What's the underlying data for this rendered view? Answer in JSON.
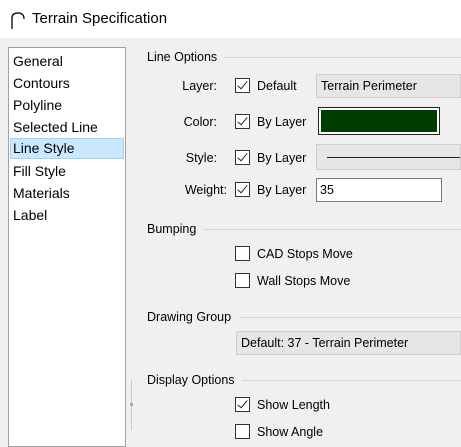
{
  "window": {
    "title": "Terrain Specification"
  },
  "nav": {
    "items": [
      {
        "label": "General"
      },
      {
        "label": "Contours"
      },
      {
        "label": "Polyline"
      },
      {
        "label": "Selected Line"
      },
      {
        "label": "Line Style",
        "selected": true
      },
      {
        "label": "Fill Style"
      },
      {
        "label": "Materials"
      },
      {
        "label": "Label"
      }
    ]
  },
  "line_options": {
    "heading": "Line Options",
    "layer": {
      "label": "Layer:",
      "checkbox_label": "Default",
      "checked": true,
      "value": "Terrain Perimeter"
    },
    "color": {
      "label": "Color:",
      "checkbox_label": "By Layer",
      "checked": true,
      "swatch": "#003d00"
    },
    "style": {
      "label": "Style:",
      "checkbox_label": "By Layer",
      "checked": true
    },
    "weight": {
      "label": "Weight:",
      "checkbox_label": "By Layer",
      "checked": true,
      "value": "35"
    }
  },
  "bumping": {
    "heading": "Bumping",
    "cad_stops_move": {
      "label": "CAD Stops Move",
      "checked": false
    },
    "wall_stops_move": {
      "label": "Wall Stops Move",
      "checked": false
    }
  },
  "drawing_group": {
    "heading": "Drawing Group",
    "value": "Default: 37 - Terrain Perimeter"
  },
  "display_options": {
    "heading": "Display Options",
    "show_length": {
      "label": "Show Length",
      "checked": true
    },
    "show_angle": {
      "label": "Show Angle",
      "checked": false
    }
  },
  "colors": {
    "selection_bg": "#cce8ff",
    "selection_border": "#99d1ff"
  }
}
